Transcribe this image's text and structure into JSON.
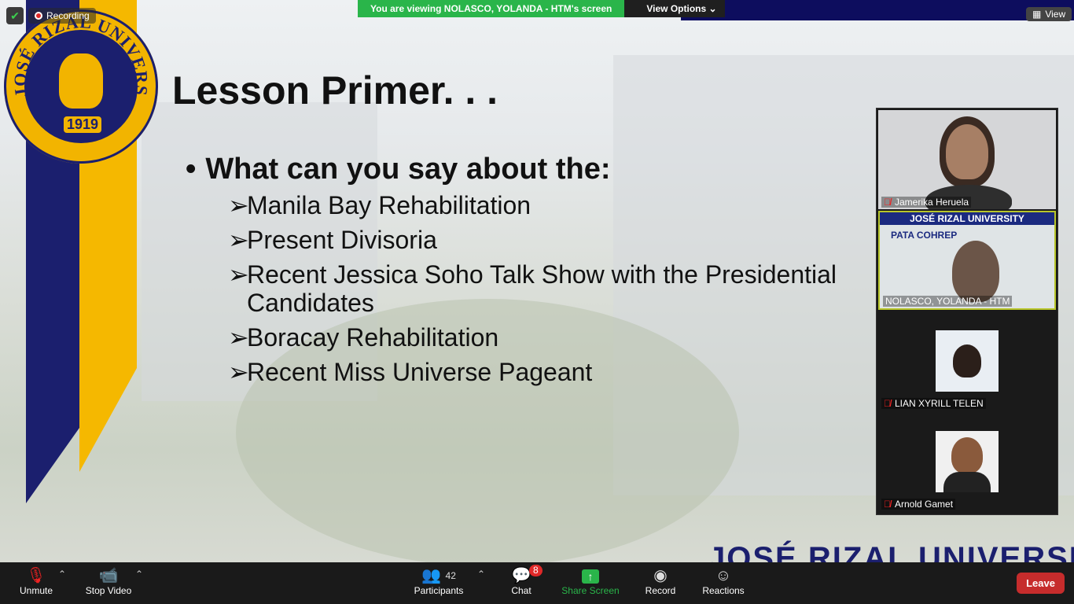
{
  "recording": {
    "label": "Recording"
  },
  "banner": {
    "message": "You are viewing NOLASCO, YOLANDA - HTM's screen",
    "view_options": "View Options"
  },
  "view_button": {
    "label": "View"
  },
  "slide": {
    "seal_year": "1919",
    "seal_text": "JOSÉ RIZAL UNIVERSITY",
    "title": "Lesson Primer. . .",
    "bullet": "•",
    "question": "What can you say about the:",
    "arrow": "➢",
    "items": [
      "Manila Bay Rehabilitation",
      "Present Divisoria",
      "Recent Jessica Soho Talk Show with the Presidential Candidates",
      "Boracay Rehabilitation",
      "Recent Miss Universe Pageant"
    ],
    "watermark": "JOSÉ RIZAL UNIVERSITY"
  },
  "participants_gallery": [
    {
      "name": "Jamerika Heruela",
      "muted": true
    },
    {
      "name": "NOLASCO, YOLANDA - HTM",
      "muted": false,
      "header": "JOSÉ RIZAL UNIVERSITY",
      "logos": "PATA  COHREP"
    },
    {
      "name": "LIAN XYRILL TELEN",
      "muted": true
    },
    {
      "name": "Arnold Gamet",
      "muted": true
    }
  ],
  "toolbar": {
    "unmute": "Unmute",
    "stop_video": "Stop Video",
    "participants": "Participants",
    "participants_count": "42",
    "chat": "Chat",
    "chat_badge": "8",
    "share_screen": "Share Screen",
    "record": "Record",
    "reactions": "Reactions",
    "leave": "Leave"
  },
  "colors": {
    "jru_blue": "#1b1f6e",
    "jru_gold": "#f5b800",
    "share_green": "#2ab54a",
    "leave_red": "#c62c2c"
  }
}
